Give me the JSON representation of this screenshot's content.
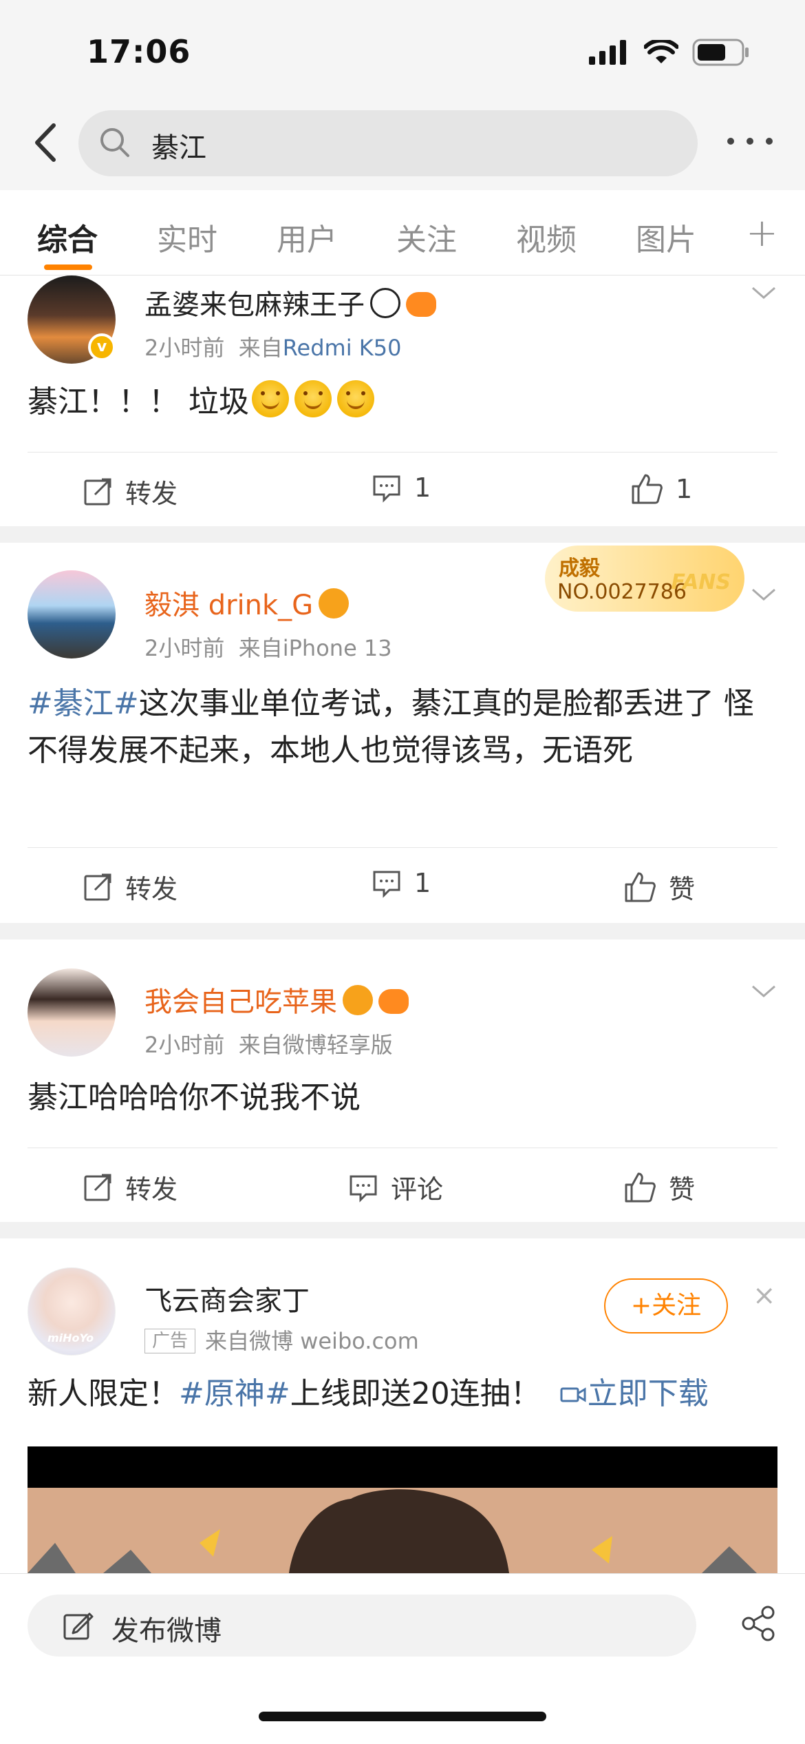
{
  "status_bar": {
    "time": "17:06"
  },
  "search": {
    "query": "綦江"
  },
  "tabs": [
    {
      "label": "综合"
    },
    {
      "label": "实时"
    },
    {
      "label": "用户"
    },
    {
      "label": "关注"
    },
    {
      "label": "视频"
    },
    {
      "label": "图片"
    }
  ],
  "tab_plus": "+",
  "posts": [
    {
      "username": "孟婆来包麻辣王子",
      "time": "2小时前",
      "from_prefix": "来自",
      "source": "Redmi K50",
      "content": "綦江！！！ 垃圾",
      "actions": {
        "repost": "转发",
        "comment": "1",
        "like": "1"
      }
    },
    {
      "username": "毅淇 drink_G",
      "time": "2小时前",
      "from_prefix": "来自",
      "source": "iPhone 13",
      "fans_badge": {
        "name": "成毅",
        "number": "NO.0027786",
        "word": "FANS"
      },
      "hashtag": "#綦江#",
      "content": "这次事业单位考试，綦江真的是脸都丢进了 怪不得发展不起来，本地人也觉得该骂，无语死",
      "actions": {
        "repost": "转发",
        "comment": "1",
        "like": "赞"
      }
    },
    {
      "username": "我会自己吃苹果",
      "time": "2小时前",
      "from_prefix": "来自",
      "source": "微博轻享版",
      "content": "綦江哈哈哈你不说我不说",
      "actions": {
        "repost": "转发",
        "comment": "评论",
        "like": "赞"
      }
    },
    {
      "username": "飞云商会家丁",
      "ad_label": "广告",
      "source": "来自微博 weibo.com",
      "follow": "+关注",
      "close": "×",
      "content_prefix": "新人限定！",
      "hashtag": "#原神#",
      "content_suffix": "上线即送20连抽！",
      "download": "立即下载",
      "avatar_text": "miHoYo"
    }
  ],
  "bottom": {
    "compose_label": "发布微博"
  },
  "colors": {
    "accent": "#ff8200",
    "link": "#4a75a8",
    "vip_name": "#e8641b"
  }
}
